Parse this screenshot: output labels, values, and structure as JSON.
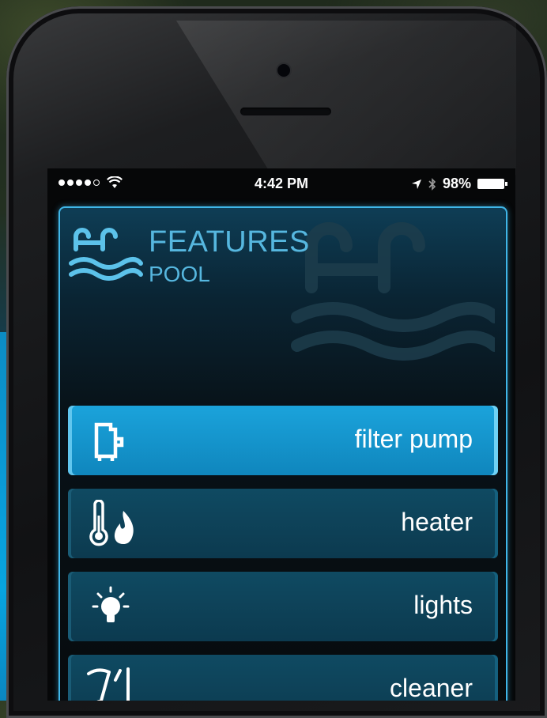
{
  "status_bar": {
    "time": "4:42 PM",
    "battery": "98%",
    "signal_icon": "signal-dots-icon",
    "wifi_icon": "wifi-icon",
    "location_icon": "location-arrow-icon",
    "bluetooth_icon": "bluetooth-icon"
  },
  "header": {
    "title": "FEATURES",
    "subtitle": "POOL",
    "icon": "pool-ladder-waves-icon"
  },
  "features": [
    {
      "label": "filter pump",
      "icon": "filter-pump-icon",
      "active": true
    },
    {
      "label": "heater",
      "icon": "thermometer-flame-icon",
      "active": false
    },
    {
      "label": "lights",
      "icon": "light-bulb-icon",
      "active": false
    },
    {
      "label": "cleaner",
      "icon": "pool-cleaner-icon",
      "active": false
    }
  ],
  "colors": {
    "accent": "#3fb6e8",
    "active_row": "#1ba3db",
    "inactive_row": "#0f4a62",
    "title_text": "#56b7df"
  }
}
